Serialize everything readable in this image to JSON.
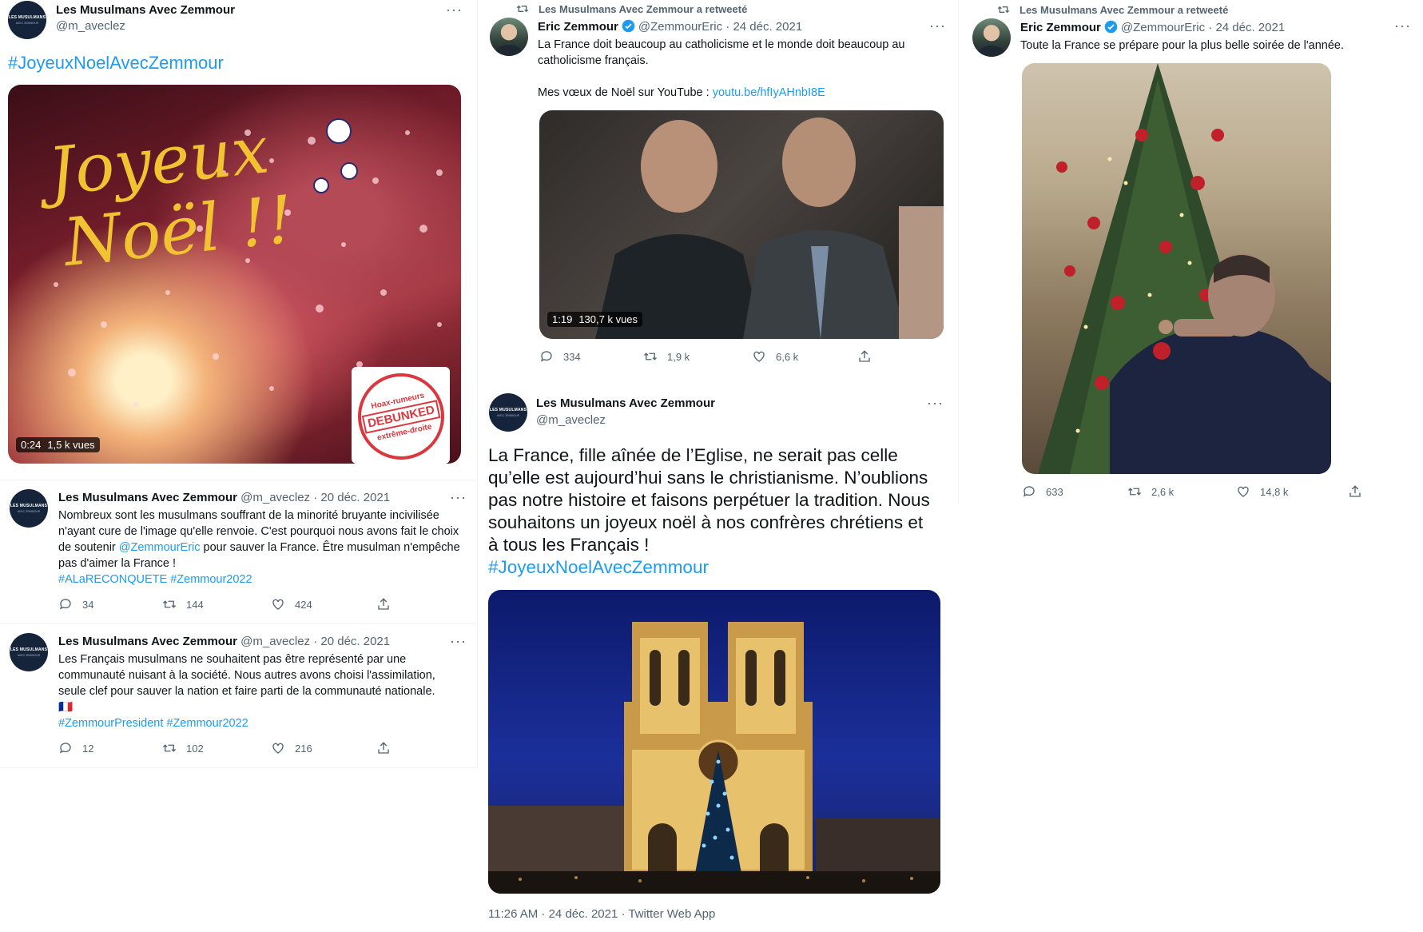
{
  "col1": {
    "top_tweet": {
      "name": "Les Musulmans Avec Zemmour",
      "handle": "@m_aveclez",
      "hashtag": "#JoyeuxNoelAvecZemmour",
      "video": {
        "overlay_line1": "Joyeux",
        "overlay_line2": "Noël !!",
        "duration": "0:24",
        "views": "1,5 k vues",
        "stamp_top": "Hoax-rumeurs",
        "stamp_mid": "DEBUNKED",
        "stamp_bottom": "extrême-droite"
      }
    },
    "reply1": {
      "name": "Les Musulmans Avec Zemmour",
      "handle_date": "@m_aveclez · 20 déc. 2021",
      "text_a": "Nombreux sont les musulmans souffrant de la minorité bruyante incivilisée n'ayant cure de l'image qu'elle renvoie. C'est pourquoi nous avons fait le choix de soutenir ",
      "mention": "@ZemmourEric",
      "text_b": " pour sauver la France. Être musulman n'empêche pas d'aimer la France !",
      "hashtags": "#ALaRECONQUETE #Zemmour2022",
      "replies": "34",
      "retweets": "144",
      "likes": "424"
    },
    "reply2": {
      "name": "Les Musulmans Avec Zemmour",
      "handle_date": "@m_aveclez · 20 déc. 2021",
      "text": "Les Français musulmans ne souhaitent pas être représenté par une communauté nuisant à la société. Nous autres avons choisi l'assimilation, seule clef pour sauver la nation et faire parti de la communauté nationale.",
      "hashtags": "#ZemmourPresident #Zemmour2022",
      "replies": "12",
      "retweets": "102",
      "likes": "216"
    },
    "avatar_text1": "LES MUSULMANS",
    "avatar_text2": "AVEC ZEMMOUR"
  },
  "col2": {
    "retweet_label": "Les Musulmans Avec Zemmour a retweeté",
    "rt_tweet": {
      "name": "Eric Zemmour",
      "handle_date": "@ZemmourEric · 24 déc. 2021",
      "text": "La France doit beaucoup au catholicisme et le monde doit beaucoup au catholicisme français.",
      "youtube_prefix": "Mes vœux de Noël sur YouTube : ",
      "youtube_link": "youtu.be/hfIyAHnbI8E",
      "video_duration": "1:19",
      "video_views": "130,7 k vues",
      "replies": "334",
      "retweets": "1,9 k",
      "likes": "6,6 k"
    },
    "main_tweet": {
      "name": "Les Musulmans Avec Zemmour",
      "handle": "@m_aveclez",
      "text": "La France, fille aînée de l’Eglise, ne serait pas celle qu’elle est aujourd’hui sans le christianisme. N’oublions pas notre histoire et faisons perpétuer la tradition. Nous souhaitons un joyeux noël à nos confrères chrétiens et à tous les Français !",
      "hashtag": "#JoyeuxNoelAvecZemmour",
      "timestamp": "11:26 AM · 24 déc. 2021 · Twitter Web App"
    }
  },
  "col3": {
    "retweet_label": "Les Musulmans Avec Zemmour a retweeté",
    "name": "Eric Zemmour",
    "handle_date": "@ZemmourEric · 24 déc. 2021",
    "text": "Toute la France se prépare pour la plus belle soirée de l'année.",
    "replies": "633",
    "retweets": "2,6 k",
    "likes": "14,8 k"
  },
  "flag_emoji": "🇫🇷",
  "more_glyph": "···",
  "colors": {
    "link": "#1d9bf0",
    "secondary": "#536471",
    "verified": "#1d9bf0"
  }
}
